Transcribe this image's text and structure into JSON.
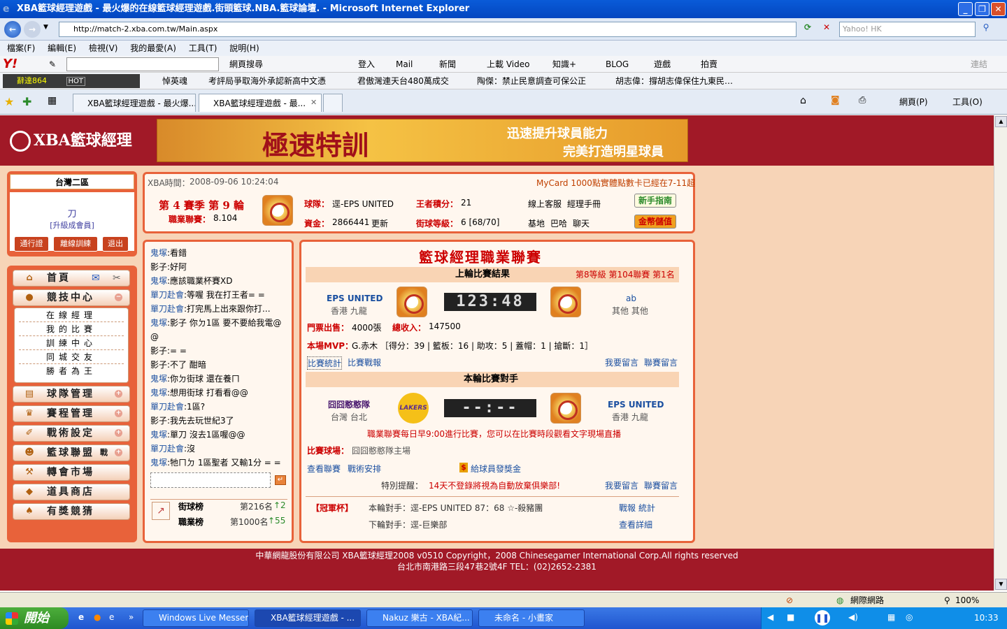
{
  "window": {
    "title": "XBA籃球經理遊戲 - 最火爆的在線籃球經理遊戲.街頭籃球.NBA.籃球論壇. - Microsoft Internet Explorer",
    "address": "http://match-2.xba.com.tw/Main.aspx",
    "search_placeholder": "Yahoo! HK"
  },
  "menu": [
    "檔案(F)",
    "編輯(E)",
    "檢視(V)",
    "我的最愛(A)",
    "工具(T)",
    "說明(H)"
  ],
  "links_label": "連結",
  "yahoo_toolbar": {
    "search_label": "網頁搜尋",
    "items": [
      "登入",
      "Mail",
      "新聞",
      "上載 Video",
      "知識+",
      "BLOG",
      "遊戲",
      "拍賣"
    ]
  },
  "links_bar": {
    "ticker": "辭達864",
    "hot": "HOT",
    "items": [
      "悼英魂",
      "考評局爭取海外承認新高中文憑",
      "君傲灣連天台480萬成交",
      "陶傑：禁止民意調查可保公正",
      "胡志偉：撐胡志偉保住九東民…"
    ]
  },
  "tabs": [
    {
      "label": "XBA籃球經理遊戲 - 最火爆..."
    },
    {
      "label": "XBA籃球經理遊戲 - 最...",
      "active": true
    }
  ],
  "tab_tools": [
    "網頁(P)",
    "工具(O)"
  ],
  "site": {
    "logo": "XBA籃球經理",
    "banner_main": "極速特訓",
    "banner_sub1": "迅速提升球員能力",
    "banner_sub2": "完美打造明星球員"
  },
  "user": {
    "region": "台灣二區",
    "name": "刀",
    "grade": "[升級成會員]",
    "buttons": [
      "通行證",
      "離線訓練",
      "退出"
    ]
  },
  "nav": {
    "home": "首頁",
    "competition": "競技中心",
    "sub": [
      "在線經理",
      "我的比賽",
      "訓練中心",
      "同城交友",
      "勝者為王"
    ],
    "items": [
      "球隊管理",
      "賽程管理",
      "戰術設定",
      "籃球聯盟",
      "轉會市場",
      "道具商店",
      "有獎競猜"
    ],
    "league_badge": "戰"
  },
  "info": {
    "time_label": "XBA時間：",
    "time": "2008-09-06 10:24:04",
    "notice": "MyCard 1000點實體點數卡已經在7-11超",
    "season": "第 4 賽季 第 9 輪",
    "league_label": "職業聯賽：",
    "league_value": "8.104",
    "team_label": "球隊：",
    "team": "逕-EPS UNITED",
    "king_label": "王者積分：",
    "king": "21",
    "funds_label": "資金：",
    "funds": "2866441",
    "update": "更新",
    "street_label": "街球等級：",
    "street": "6 [68/70]",
    "links1": [
      "線上客服",
      "經理手冊"
    ],
    "links2": [
      "基地",
      "巴哈",
      "聊天"
    ],
    "btn_guide": "新手指南",
    "btn_pay": "金幣儲值"
  },
  "chat": [
    {
      "n": "鬼塚",
      "t": ":看錯"
    },
    {
      "n": "",
      "t": "影子:好阿"
    },
    {
      "n": "鬼塚",
      "t": ":應該職業杯賽XD"
    },
    {
      "n": "單刀赴會",
      "t": ":等喔 我在打王者= ="
    },
    {
      "n": "單刀赴會",
      "t": ":打完馬上出來跟你打..."
    },
    {
      "n": "鬼塚",
      "t": ":影子 你ㄉ1區 要不要給我電@"
    },
    {
      "n": "",
      "t": "@"
    },
    {
      "n": "",
      "t": "影子:= ="
    },
    {
      "n": "",
      "t": "影子:不了 酣暗"
    },
    {
      "n": "鬼塚",
      "t": ":你ㄉ街球 還在養ㄇ"
    },
    {
      "n": "鬼塚",
      "t": ":想用街球 打看看@@"
    },
    {
      "n": "單刀赴會",
      "t": ":1區?"
    },
    {
      "n": "",
      "t": "影子:我先去玩世紀3了"
    },
    {
      "n": "鬼塚",
      "t": ":單刀 沒去1區喔@@"
    },
    {
      "n": "單刀赴會",
      "t": ":沒"
    },
    {
      "n": "鬼塚",
      "t": ":牠ㄇㄉ 1區聖者 又輸1分 = ="
    }
  ],
  "ranks": {
    "street_label": "街球榜",
    "street_rank": "第216名",
    "street_change": "↑2",
    "pro_label": "職業榜",
    "pro_rank": "第1000名",
    "pro_change": "↑55"
  },
  "league": {
    "title": "籃球經理職業聯賽",
    "last_result": "上輪比賽結果",
    "last_info": "第8等級 第104聯賽 第1名",
    "home_team": "EPS UNITED",
    "home_city": "香港 九龍",
    "score": "123:48",
    "away_team": "ab",
    "away_city": "其他 其他",
    "tickets_label": "門票出售：",
    "tickets": "4000張",
    "income_label": "總收入：",
    "income": "147500",
    "mvp_label": "本場MVP：",
    "mvp": "G.赤木 ［得分：39 | 籃板：16 | 助攻：5 | 蓋帽：1 | 搶斷：1］",
    "stats_link": "比賽統計",
    "report_link": "比賽戰報",
    "msg1": "我要留言",
    "msg2": "聯賽留言",
    "this_round": "本輪比賽對手",
    "opp_team": "囧囧憨憨隊",
    "opp_city": "台灣 台北",
    "opp_logo": "LAKERS",
    "score2": "--:--",
    "my_team": "EPS UNITED",
    "my_city": "香港 九龍",
    "daily_note": "職業聯賽每日早9:00進行比賽，您可以在比賽時段觀看文字現場直播",
    "venue_label": "比賽球場：",
    "venue": "囧囧憨憨隊主場",
    "view_league": "查看聯賽",
    "tactics": "戰術安排",
    "bonus": "給球員發獎金",
    "reminder_label": "特別提醒：",
    "reminder": "14天不登錄將視為自動放棄俱樂部!",
    "cup_label": "【冠軍杯】",
    "cup_this": "本輪對手：逕-EPS UNITED 87：68 ☆-殺豬團",
    "cup_next": "下輪對手：逕-巨樂部",
    "cup_report": "戰報",
    "cup_stats": "統計",
    "cup_detail": "查看詳細"
  },
  "footer": {
    "line1": "中華網龍股份有限公司 XBA籃球經理2008 v0510 Copyright，2008 Chinesegamer International Corp.All rights reserved",
    "line2": "台北市南港路三段47巷2號4F TEL：(02)2652-2381"
  },
  "status": {
    "zone": "網際網路",
    "zoom": "100%"
  },
  "taskbar": {
    "start": "開始",
    "items": [
      "Windows Live Messen...",
      "XBA籃球經理遊戲 - ...",
      "Nakuz 樂古 - XBA紀...",
      "未命名 - 小畫家"
    ],
    "clock": "10:33"
  }
}
